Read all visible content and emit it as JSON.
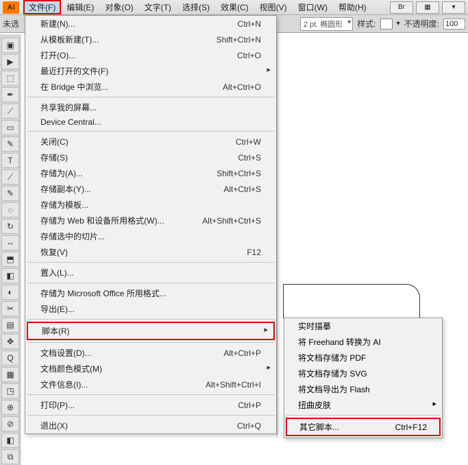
{
  "menubar": {
    "logo": "Ai",
    "items": [
      {
        "label": "文件(F)",
        "hl": true
      },
      {
        "label": "编辑(E)"
      },
      {
        "label": "对象(O)"
      },
      {
        "label": "文字(T)"
      },
      {
        "label": "选择(S)"
      },
      {
        "label": "效果(C)"
      },
      {
        "label": "视图(V)"
      },
      {
        "label": "窗口(W)"
      },
      {
        "label": "帮助(H)"
      }
    ],
    "brBtn": "Br",
    "gridBtn": "▦"
  },
  "toolbar": {
    "left_text": "未选",
    "stroke_label": "2 pt. 椭圆形",
    "style_label": "样式:",
    "opacity_label": "不透明度:",
    "opacity_value": "100"
  },
  "file_menu": [
    {
      "t": "item",
      "label": "新建(N)...",
      "key": "Ctrl+N"
    },
    {
      "t": "item",
      "label": "从模板新建(T)...",
      "key": "Shift+Ctrl+N"
    },
    {
      "t": "item",
      "label": "打开(O)...",
      "key": "Ctrl+O"
    },
    {
      "t": "item",
      "label": "最近打开的文件(F)",
      "sub": true
    },
    {
      "t": "item",
      "label": "在 Bridge 中浏览...",
      "key": "Alt+Ctrl+O"
    },
    {
      "t": "sep"
    },
    {
      "t": "item",
      "label": "共享我的屏幕..."
    },
    {
      "t": "item",
      "label": "Device Central..."
    },
    {
      "t": "sep"
    },
    {
      "t": "item",
      "label": "关闭(C)",
      "key": "Ctrl+W"
    },
    {
      "t": "item",
      "label": "存储(S)",
      "key": "Ctrl+S"
    },
    {
      "t": "item",
      "label": "存储为(A)...",
      "key": "Shift+Ctrl+S"
    },
    {
      "t": "item",
      "label": "存储副本(Y)...",
      "key": "Alt+Ctrl+S"
    },
    {
      "t": "item",
      "label": "存储为模板..."
    },
    {
      "t": "item",
      "label": "存储为 Web 和设备所用格式(W)...",
      "key": "Alt+Shift+Ctrl+S"
    },
    {
      "t": "item",
      "label": "存储选中的切片..."
    },
    {
      "t": "item",
      "label": "恢复(V)",
      "key": "F12"
    },
    {
      "t": "sep"
    },
    {
      "t": "item",
      "label": "置入(L)..."
    },
    {
      "t": "sep"
    },
    {
      "t": "item",
      "label": "存储为 Microsoft Office 所用格式..."
    },
    {
      "t": "item",
      "label": "导出(E)..."
    },
    {
      "t": "sep"
    },
    {
      "t": "item",
      "label": "脚本(R)",
      "sub": true,
      "hl": true
    },
    {
      "t": "sep"
    },
    {
      "t": "item",
      "label": "文档设置(D)...",
      "key": "Alt+Ctrl+P"
    },
    {
      "t": "item",
      "label": "文档颜色模式(M)",
      "sub": true
    },
    {
      "t": "item",
      "label": "文件信息(I)...",
      "key": "Alt+Shift+Ctrl+I"
    },
    {
      "t": "sep"
    },
    {
      "t": "item",
      "label": "打印(P)...",
      "key": "Ctrl+P"
    },
    {
      "t": "sep"
    },
    {
      "t": "item",
      "label": "退出(X)",
      "key": "Ctrl+Q"
    }
  ],
  "script_submenu": [
    {
      "t": "item",
      "label": "实时描摹"
    },
    {
      "t": "item",
      "label": "将 Freehand 转换为 AI"
    },
    {
      "t": "item",
      "label": "将文档存储为 PDF"
    },
    {
      "t": "item",
      "label": "将文档存储为 SVG"
    },
    {
      "t": "item",
      "label": "将文档导出为 Flash"
    },
    {
      "t": "item",
      "label": "扭曲皮肤",
      "sub": true
    },
    {
      "t": "sep"
    },
    {
      "t": "item",
      "label": "其它脚本...",
      "key": "Ctrl+F12",
      "hl": true
    }
  ],
  "tools": [
    "▣",
    "▶",
    "⬚",
    "✒",
    "⟋",
    "▭",
    "✎",
    "T",
    "⟋",
    "✎",
    "◌",
    "↻",
    "⇔",
    "⬒",
    "◧",
    "◐",
    "✂",
    "▤",
    "✥",
    "Q",
    "▦",
    "◳",
    "⊕",
    "⊘",
    "◧",
    "⧉"
  ]
}
